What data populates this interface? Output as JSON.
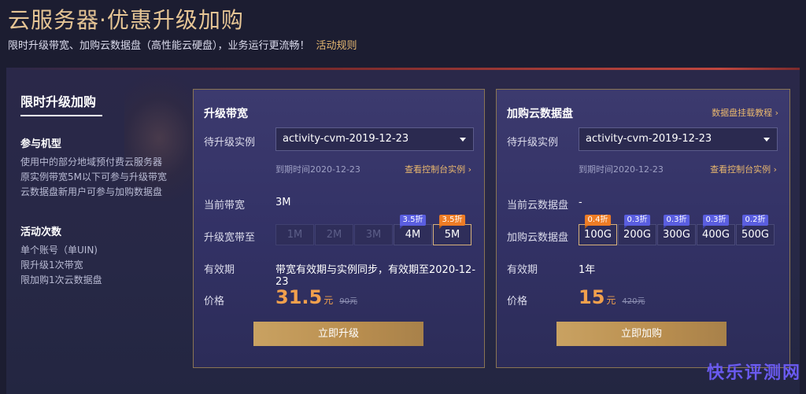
{
  "header": {
    "title": "云服务器·优惠升级加购",
    "subtitle": "限时升级带宽、加购云数据盘（高性能云硬盘），业务运行更流畅！",
    "rules_link": "活动规则"
  },
  "left_panel": {
    "title": "限时升级加购",
    "mechanism_title": "参与机型",
    "mechanism_lines": [
      "使用中的部分地域预付费云服务器",
      "原实例带宽5M以下可参与升级带宽",
      "云数据盘新用户可参与加购数据盘"
    ],
    "times_title": "活动次数",
    "times_lines": [
      "单个账号（单UIN)",
      "限升级1次带宽",
      "限加购1次云数据盘"
    ]
  },
  "bandwidth_card": {
    "title": "升级带宽",
    "instance_label": "待升级实例",
    "instance_value": "activity-cvm-2019-12-23",
    "expire_text": "到期时间2020-12-23",
    "console_link": "查看控制台实例 ›",
    "current_label": "当前带宽",
    "current_value": "3M",
    "upgrade_label": "升级宽带至",
    "options": [
      {
        "label": "1M",
        "state": "disabled",
        "tag": "",
        "tag_color": ""
      },
      {
        "label": "2M",
        "state": "disabled",
        "tag": "",
        "tag_color": ""
      },
      {
        "label": "3M",
        "state": "disabled",
        "tag": "",
        "tag_color": ""
      },
      {
        "label": "4M",
        "state": "normal",
        "tag": "3.5折",
        "tag_color": "blue"
      },
      {
        "label": "5M",
        "state": "selected",
        "tag": "3.5折",
        "tag_color": "orange"
      }
    ],
    "validity_label": "有效期",
    "validity_value": "带宽有效期与实例同步，有效期至2020-12-23",
    "price_label": "价格",
    "price": "31.5",
    "unit": "元",
    "original_price": "90元",
    "button": "立即升级"
  },
  "disk_card": {
    "title": "加购云数据盘",
    "tutorial_link": "数据盘挂载教程 ›",
    "instance_label": "待升级实例",
    "instance_value": "activity-cvm-2019-12-23",
    "expire_text": "到期时间2020-12-23",
    "console_link": "查看控制台实例 ›",
    "current_label": "当前云数据盘",
    "current_value": "-",
    "buy_label": "加购云数据盘",
    "options": [
      {
        "label": "100G",
        "state": "selected",
        "tag": "0.4折",
        "tag_color": "orange"
      },
      {
        "label": "200G",
        "state": "normal",
        "tag": "0.3折",
        "tag_color": "blue"
      },
      {
        "label": "300G",
        "state": "normal",
        "tag": "0.3折",
        "tag_color": "blue"
      },
      {
        "label": "400G",
        "state": "normal",
        "tag": "0.3折",
        "tag_color": "blue"
      },
      {
        "label": "500G",
        "state": "normal",
        "tag": "0.2折",
        "tag_color": "blue"
      }
    ],
    "validity_label": "有效期",
    "validity_value": "1年",
    "price_label": "价格",
    "price": "15",
    "unit": "元",
    "original_price": "420元",
    "button": "立即加购"
  },
  "watermark": "快乐评测网"
}
